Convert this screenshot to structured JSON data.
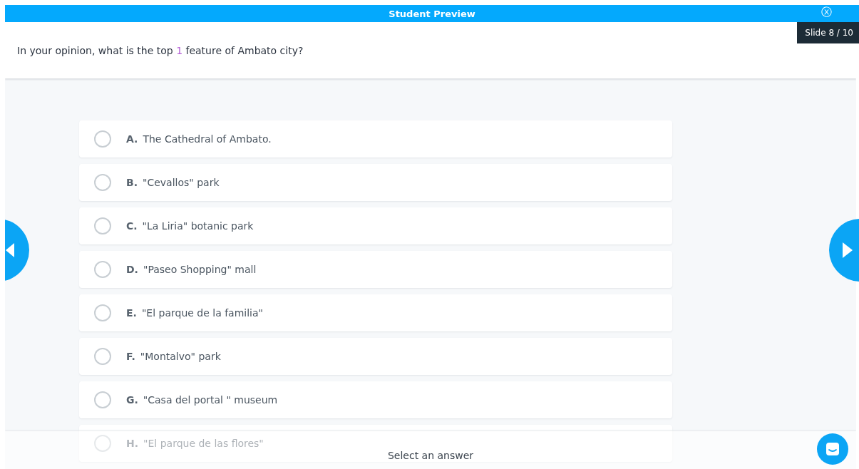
{
  "header": {
    "title": "Student Preview",
    "close": "ⓧ"
  },
  "slide_counter": "Slide 8 / 10",
  "question": {
    "before": "In your opinion, what is the top ",
    "highlight": "1",
    "after": " feature of Ambato city?"
  },
  "options": [
    {
      "letter": "A.",
      "text": "The Cathedral of Ambato.",
      "selected": false
    },
    {
      "letter": "B.",
      "text": "\"Cevallos\" park",
      "selected": false
    },
    {
      "letter": "C.",
      "text": "\"La Liria\" botanic park",
      "selected": false
    },
    {
      "letter": "D.",
      "text": "\"Paseo Shopping\" mall",
      "selected": false
    },
    {
      "letter": "E.",
      "text": "\"El parque de la familia\"",
      "selected": false
    },
    {
      "letter": "F.",
      "text": "\"Montalvo\" park",
      "selected": false
    },
    {
      "letter": "G.",
      "text": "\"Casa del portal \" museum",
      "selected": false
    },
    {
      "letter": "H.",
      "text": "\"El parque de las flores\"",
      "selected": false
    }
  ],
  "footer": {
    "status": "Select an answer"
  }
}
